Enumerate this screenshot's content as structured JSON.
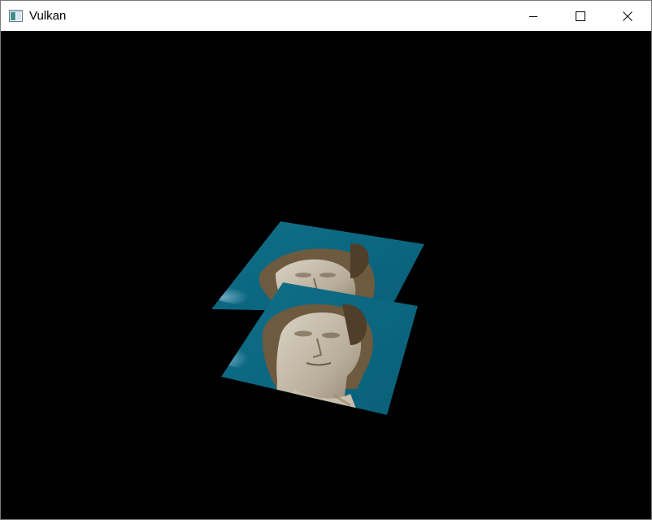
{
  "window": {
    "title": "Vulkan",
    "icon": "app-window-icon"
  },
  "titlebar_buttons": {
    "minimize_icon": "minimize-icon",
    "maximize_icon": "maximize-icon",
    "close_icon": "close-icon"
  },
  "viewport": {
    "background": "#000000",
    "content": [
      {
        "name": "textured-quad-back",
        "image": "statue-head-photo"
      },
      {
        "name": "textured-quad-front",
        "image": "statue-head-photo"
      }
    ]
  },
  "colors": {
    "sky_teal": "#0f6f86",
    "sky_light": "#4aa3c2",
    "statue_stone": "#cfc6b6"
  }
}
